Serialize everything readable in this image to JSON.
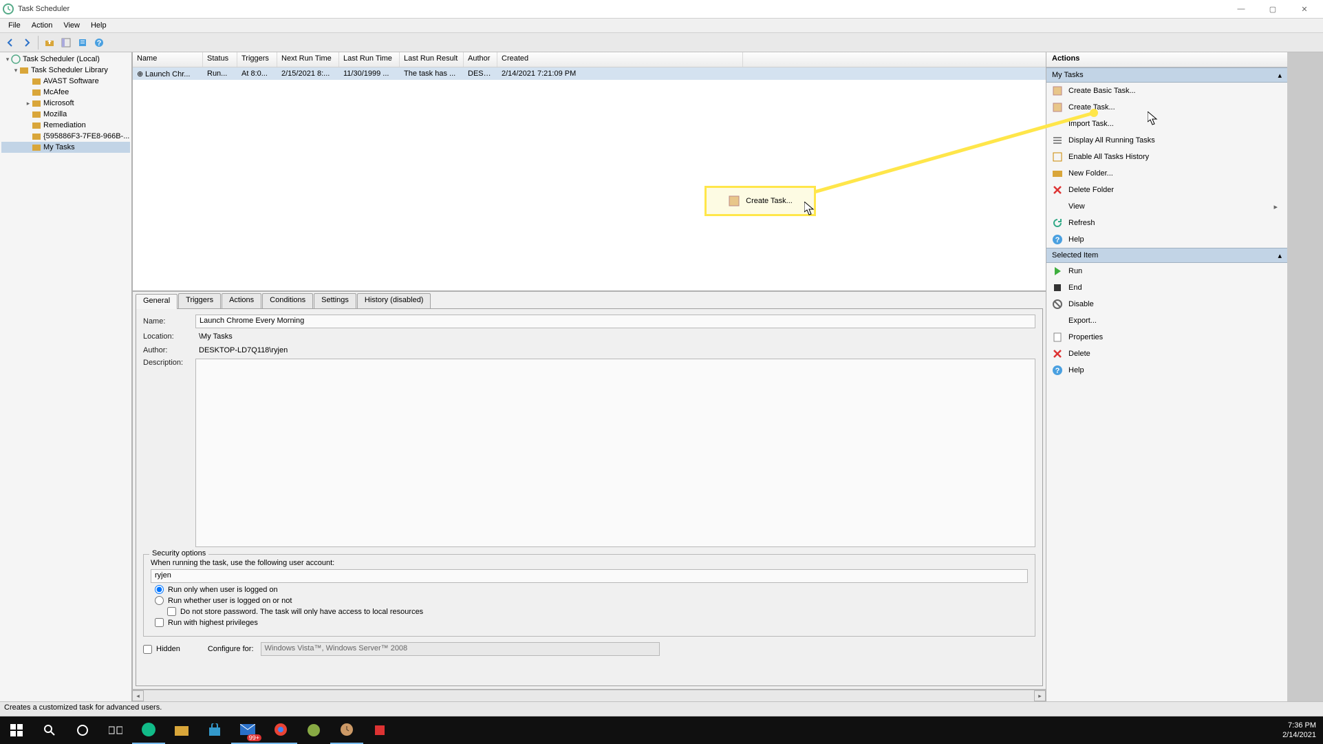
{
  "window": {
    "title": "Task Scheduler"
  },
  "menu": {
    "file": "File",
    "action": "Action",
    "view": "View",
    "help": "Help"
  },
  "tree": {
    "root": "Task Scheduler (Local)",
    "library": "Task Scheduler Library",
    "items": [
      "AVAST Software",
      "McAfee",
      "Microsoft",
      "Mozilla",
      "Remediation",
      "{595886F3-7FE8-966B-...",
      "My Tasks"
    ]
  },
  "tasklist": {
    "headers": {
      "name": "Name",
      "status": "Status",
      "triggers": "Triggers",
      "nextrun": "Next Run Time",
      "lastrun": "Last Run Time",
      "lastresult": "Last Run Result",
      "author": "Author",
      "created": "Created"
    },
    "row": {
      "name": "Launch Chr...",
      "status": "Run...",
      "triggers": "At 8:0...",
      "nextrun": "2/15/2021 8:...",
      "lastrun": "11/30/1999 ...",
      "lastresult": "The task has ...",
      "author": "DESK...",
      "created": "2/14/2021 7:21:09 PM"
    }
  },
  "tabs": {
    "general": "General",
    "triggers": "Triggers",
    "actions": "Actions",
    "conditions": "Conditions",
    "settings": "Settings",
    "history": "History (disabled)"
  },
  "general": {
    "name_label": "Name:",
    "name_value": "Launch Chrome Every Morning",
    "location_label": "Location:",
    "location_value": "\\My Tasks",
    "author_label": "Author:",
    "author_value": "DESKTOP-LD7Q118\\ryjen",
    "description_label": "Description:",
    "description_value": "",
    "security_legend": "Security options",
    "user_account_label": "When running the task, use the following user account:",
    "user_account_value": "ryjen",
    "radio_logged_on": "Run only when user is logged on",
    "radio_whether": "Run whether user is logged on or not",
    "chk_nostore": "Do not store password.  The task will only have access to local resources",
    "chk_highest": "Run with highest privileges",
    "chk_hidden": "Hidden",
    "configure_label": "Configure for:",
    "configure_value": "Windows Vista™, Windows Server™ 2008"
  },
  "actions_panel": {
    "header": "Actions",
    "section1": "My Tasks",
    "items1": [
      "Create Basic Task...",
      "Create Task...",
      "Import Task...",
      "Display All Running Tasks",
      "Enable All Tasks History",
      "New Folder...",
      "Delete Folder",
      "View",
      "Refresh",
      "Help"
    ],
    "section2": "Selected Item",
    "items2": [
      "Run",
      "End",
      "Disable",
      "Export...",
      "Properties",
      "Delete",
      "Help"
    ]
  },
  "statusbar": {
    "text": "Creates a customized task for advanced users."
  },
  "callout": {
    "label": "Create Task..."
  },
  "clock": {
    "time": "7:36 PM",
    "date": "2/14/2021"
  },
  "notif_badge": "99+"
}
